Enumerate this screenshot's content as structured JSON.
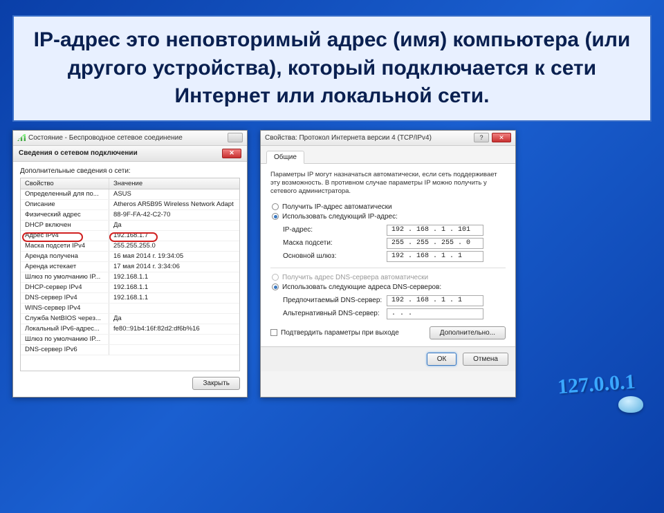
{
  "title_text": "IP-адрес это неповторимый адрес (имя) компьютера (или другого устройства), который подключается к сети Интернет или локальной сети.",
  "win1": {
    "title": "Состояние - Беспроводное сетевое соединение",
    "subtitle": "Сведения о сетевом подключении",
    "label": "Дополнительные сведения о сети:",
    "col_prop": "Свойство",
    "col_val": "Значение",
    "rows": [
      {
        "prop": "Определенный для по...",
        "val": "ASUS"
      },
      {
        "prop": "Описание",
        "val": "Atheros AR5B95 Wireless Network Adapt"
      },
      {
        "prop": "Физический адрес",
        "val": "88-9F-FA-42-C2-70"
      },
      {
        "prop": "DHCP включен",
        "val": "Да"
      },
      {
        "prop": "Адрес IPv4",
        "val": "192.168.1.7"
      },
      {
        "prop": "Маска подсети IPv4",
        "val": "255.255.255.0"
      },
      {
        "prop": "Аренда получена",
        "val": "16 мая 2014 г. 19:34:05"
      },
      {
        "prop": "Аренда истекает",
        "val": "17 мая 2014 г. 3:34:06"
      },
      {
        "prop": "Шлюз по умолчанию IP...",
        "val": "192.168.1.1"
      },
      {
        "prop": "DHCP-сервер IPv4",
        "val": "192.168.1.1"
      },
      {
        "prop": "DNS-сервер IPv4",
        "val": "192.168.1.1"
      },
      {
        "prop": "WINS-сервер IPv4",
        "val": ""
      },
      {
        "prop": "Служба NetBIOS через...",
        "val": "Да"
      },
      {
        "prop": "Локальный IPv6-адрес...",
        "val": "fe80::91b4:16f:82d2:df6b%16"
      },
      {
        "prop": "Шлюз по умолчанию IP...",
        "val": ""
      },
      {
        "prop": "DNS-сервер IPv6",
        "val": ""
      }
    ],
    "close_btn": "Закрыть"
  },
  "win2": {
    "title": "Свойства: Протокол Интернета версии 4 (TCP/IPv4)",
    "tab": "Общие",
    "info": "Параметры IP могут назначаться автоматически, если сеть поддерживает эту возможность. В противном случае параметры IP можно получить у сетевого администратора.",
    "radio_auto_ip": "Получить IP-адрес автоматически",
    "radio_manual_ip": "Использовать следующий IP-адрес:",
    "ip_label": "IP-адрес:",
    "ip_val": "192 . 168 .  1  . 101",
    "mask_label": "Маска подсети:",
    "mask_val": "255 . 255 . 255 .  0",
    "gw_label": "Основной шлюз:",
    "gw_val": "192 . 168 .  1  .  1",
    "radio_auto_dns": "Получить адрес DNS-сервера автоматически",
    "radio_manual_dns": "Использовать следующие адреса DNS-серверов:",
    "dns1_label": "Предпочитаемый DNS-сервер:",
    "dns1_val": "192 . 168 .  1  .  1",
    "dns2_label": "Альтернативный DNS-сервер:",
    "dns2_val": "  .    .    .  ",
    "confirm_chk": "Подтвердить параметры при выходе",
    "adv_btn": "Дополнительно...",
    "ok_btn": "ОК",
    "cancel_btn": "Отмена"
  },
  "graphic_text": "127.0.0.1"
}
